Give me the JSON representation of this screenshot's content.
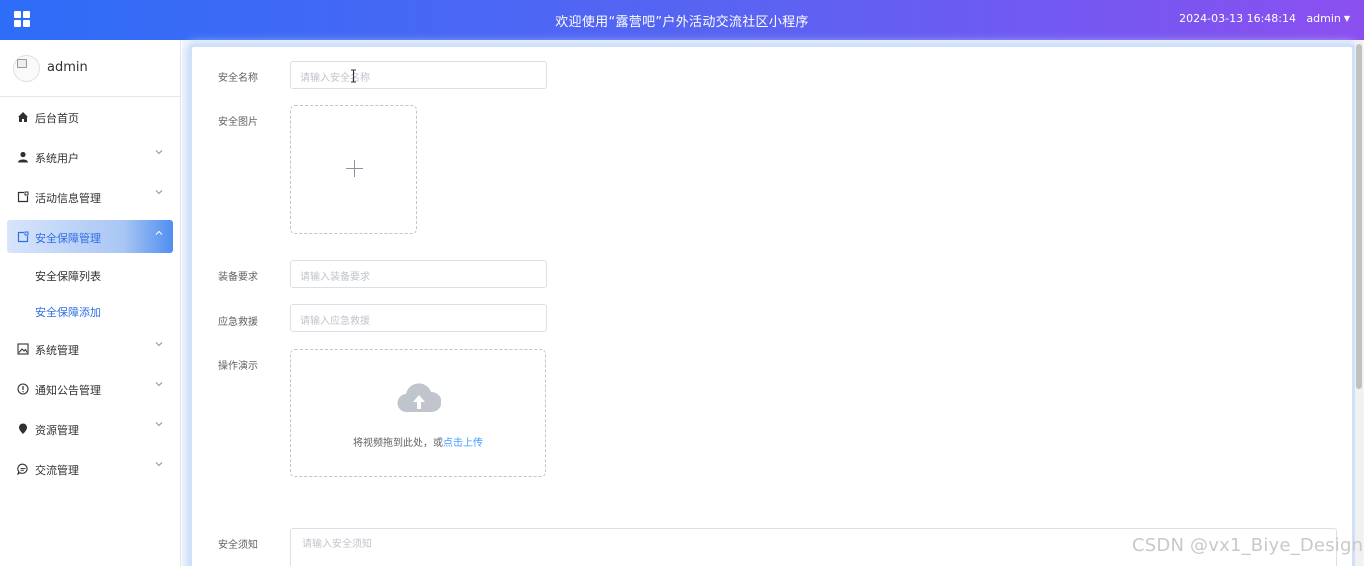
{
  "header": {
    "title": "欢迎使用“露营吧”户外活动交流社区小程序",
    "datetime": "2024-03-13 16:48:14",
    "user": "admin",
    "menu_icon": "grid-icon",
    "gradient": [
      "#2d6df7",
      "#8b4ff0"
    ]
  },
  "sidebar": {
    "user_name": "admin",
    "items": [
      {
        "label": "后台首页",
        "icon": "home-icon"
      },
      {
        "label": "系统用户",
        "icon": "user-icon"
      },
      {
        "label": "活动信息管理",
        "icon": "document-icon"
      },
      {
        "label": "安全保障管理",
        "icon": "document-icon"
      },
      {
        "label": "系统管理",
        "icon": "picture-icon"
      },
      {
        "label": "通知公告管理",
        "icon": "info-icon"
      },
      {
        "label": "资源管理",
        "icon": "location-icon"
      },
      {
        "label": "交流管理",
        "icon": "chat-icon"
      }
    ],
    "submenu": [
      {
        "label": "安全保障列表"
      },
      {
        "label": "安全保障添加"
      }
    ],
    "accent_color": "#2f6fe4"
  },
  "form": {
    "name_label": "安全名称",
    "name_placeholder": "请输入安全名称",
    "image_label": "安全图片",
    "equipment_label": "装备要求",
    "equipment_placeholder": "请输入装备要求",
    "rescue_label": "应急救援",
    "rescue_placeholder": "请输入应急救援",
    "demo_label": "操作演示",
    "upload_text": "将视频拖到此处，或",
    "upload_link": "点击上传",
    "notice_label": "安全须知",
    "notice_placeholder": "请输入安全须知"
  },
  "watermark": "CSDN @vx1_Biye_Design"
}
